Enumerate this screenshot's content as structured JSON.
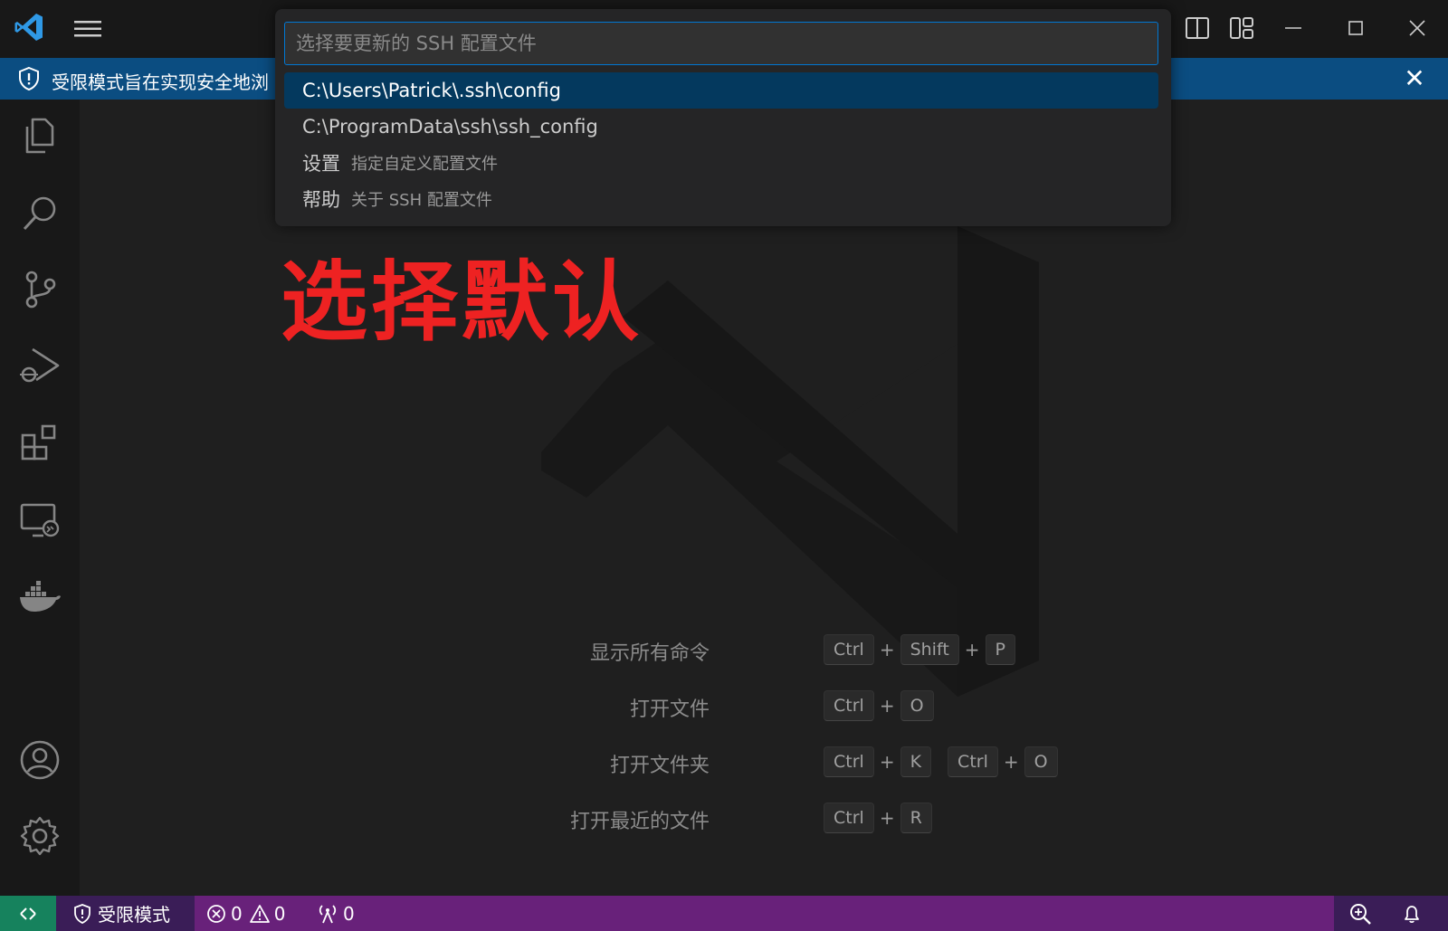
{
  "quick_pick": {
    "placeholder": "选择要更新的 SSH 配置文件",
    "items": [
      {
        "label": "C:\\Users\\Patrick\\.ssh\\config",
        "description": ""
      },
      {
        "label": "C:\\ProgramData\\ssh\\ssh_config",
        "description": ""
      },
      {
        "label": "设置",
        "description": "指定自定义配置文件"
      },
      {
        "label": "帮助",
        "description": "关于 SSH 配置文件"
      }
    ]
  },
  "banner": {
    "text": "受限模式旨在实现安全地浏",
    "close_symbol": "✕"
  },
  "annotation": {
    "text": "选择默认"
  },
  "shortcuts": [
    {
      "label": "显示所有命令",
      "keys": [
        "Ctrl",
        "Shift",
        "P"
      ]
    },
    {
      "label": "打开文件",
      "keys": [
        "Ctrl",
        "O"
      ]
    },
    {
      "label": "打开文件夹",
      "keys": [
        "Ctrl",
        "K"
      ],
      "keys2": [
        "Ctrl",
        "O"
      ]
    },
    {
      "label": "打开最近的文件",
      "keys": [
        "Ctrl",
        "R"
      ]
    }
  ],
  "status_bar": {
    "restricted_label": "受限模式",
    "errors": "0",
    "warnings": "0",
    "ports": "0"
  },
  "colors": {
    "accent": "#0078d4",
    "banner": "#0b4d81",
    "status_bar": "#68217a",
    "remote": "#16825d",
    "annotation_red": "#ee2222"
  }
}
